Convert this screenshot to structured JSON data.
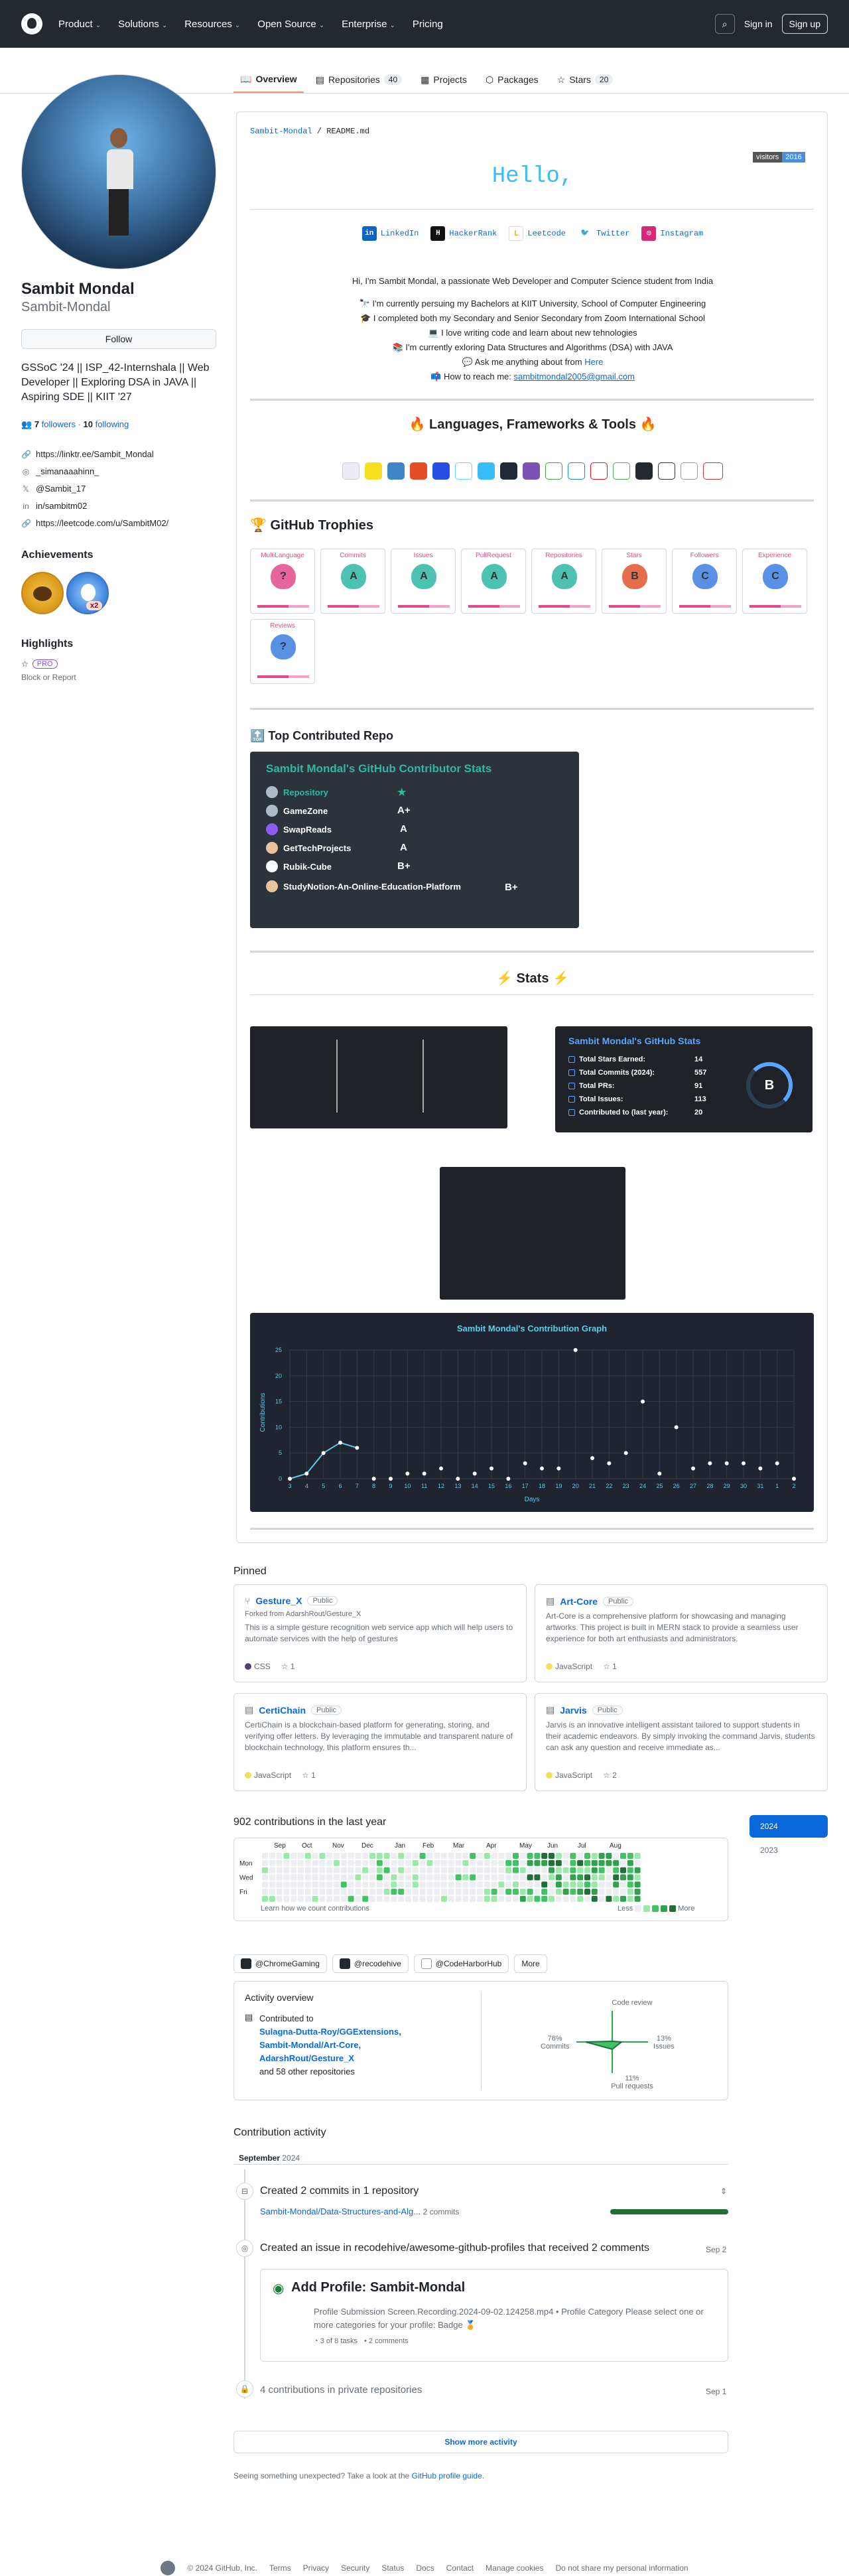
{
  "header": {
    "nav": [
      "Product",
      "Solutions",
      "Resources",
      "Open Source",
      "Enterprise",
      "Pricing"
    ],
    "sign_in": "Sign in",
    "sign_up": "Sign up"
  },
  "tabs": [
    {
      "label": "Overview"
    },
    {
      "label": "Repositories",
      "count": "40"
    },
    {
      "label": "Projects"
    },
    {
      "label": "Packages"
    },
    {
      "label": "Stars",
      "count": "20"
    }
  ],
  "profile": {
    "name": "Sambit Mondal",
    "login": "Sambit-Mondal",
    "follow": "Follow",
    "bio": "GSSoC '24 || ISP_42-Internshala || Web Developer || Exploring DSA in JAVA || Aspiring SDE || KIIT '27",
    "followers": "7",
    "followers_label": "followers",
    "following": "10",
    "following_label": "following",
    "links": [
      "https://linktr.ee/Sambit_Mondal",
      "_simanaaahinn_",
      "@Sambit_17",
      "in/sambitm02",
      "https://leetcode.com/u/SambitM02/"
    ],
    "achievements_title": "Achievements",
    "achievement_count": "x2",
    "highlights_title": "Highlights",
    "pro": "PRO",
    "block": "Block or Report"
  },
  "readme": {
    "path": "Sambit-Mondal",
    "file": "README.md",
    "hello": "Hello,",
    "visitors_label": "visitors",
    "visitors_count": "2016",
    "socials": [
      "LinkedIn",
      "HackerRank",
      "Leetcode",
      "Twitter",
      "Instagram"
    ],
    "intro": "Hi, I'm Sambit Mondal, a passionate Web Developer and Computer Science student from India",
    "points": [
      "🔭 I'm currently persuing my Bachelors at KIIT University, School of Computer Engineering",
      "🎓 I completed both my Secondary and Senior Secondary from Zoom International School",
      "💻 I love writing code and learn about new tehnologies",
      "📚 I'm currently exloring Data Structures and Algorithms (DSA) with JAVA",
      "💬 Ask me anything about from "
    ],
    "ask_link": "Here",
    "reach": "📫 How to reach me: ",
    "email": "sambitmondal2005@gmail.com",
    "langs_title": "🔥 Languages, Frameworks & Tools 🔥",
    "trophies_title": "🏆 GitHub Trophies",
    "trophies": [
      {
        "label": "MultiLanguage",
        "rank": "?",
        "color": "#e14a8b"
      },
      {
        "label": "Commits",
        "rank": "A",
        "color": "#2fb7a4"
      },
      {
        "label": "Issues",
        "rank": "A",
        "color": "#2fb7a4"
      },
      {
        "label": "PullRequest",
        "rank": "A",
        "color": "#2fb7a4"
      },
      {
        "label": "Repositories",
        "rank": "A",
        "color": "#2fb7a4"
      },
      {
        "label": "Stars",
        "rank": "B",
        "color": "#e0522d"
      },
      {
        "label": "Followers",
        "rank": "C",
        "color": "#3b7ee0"
      },
      {
        "label": "Experience",
        "rank": "C",
        "color": "#3b7ee0"
      },
      {
        "label": "Reviews",
        "rank": "?",
        "color": "#3b7ee0"
      }
    ],
    "top_repo_title": "🔝 Top Contributed Repo",
    "contrib_card": {
      "title": "Sambit Mondal's GitHub Contributor Stats",
      "rows": [
        {
          "name": "Repository",
          "rank": "★"
        },
        {
          "name": "GameZone",
          "rank": "A+"
        },
        {
          "name": "SwapReads",
          "rank": "A"
        },
        {
          "name": "GetTechProjects",
          "rank": "A"
        },
        {
          "name": "Rubik-Cube",
          "rank": "B+"
        },
        {
          "name": "StudyNotion-An-Online-Education-Platform",
          "rank": "B+"
        }
      ]
    },
    "stats_title": "⚡ Stats ⚡",
    "gh_stats": {
      "title": "Sambit Mondal's GitHub Stats",
      "rows": [
        {
          "label": "Total Stars Earned:",
          "value": "14"
        },
        {
          "label": "Total Commits (2024):",
          "value": "557"
        },
        {
          "label": "Total PRs:",
          "value": "91"
        },
        {
          "label": "Total Issues:",
          "value": "113"
        },
        {
          "label": "Contributed to (last year):",
          "value": "20"
        }
      ],
      "grade": "B"
    }
  },
  "chart_data": {
    "type": "line",
    "title": "Sambit Mondal's Contribution Graph",
    "xlabel": "Days",
    "ylabel": "Contributions",
    "x": [
      3,
      4,
      5,
      6,
      7,
      8,
      9,
      10,
      11,
      12,
      13,
      14,
      15,
      16,
      17,
      18,
      19,
      20,
      21,
      22,
      23,
      24,
      25,
      26,
      27,
      28,
      29,
      30,
      31,
      1,
      2
    ],
    "values": [
      0,
      1,
      5,
      7,
      6,
      0,
      0,
      1,
      1,
      2,
      0,
      1,
      2,
      0,
      3,
      2,
      2,
      25,
      4,
      3,
      5,
      15,
      1,
      10,
      2,
      3,
      3,
      3,
      2,
      3,
      0
    ],
    "ylim": [
      0,
      25
    ],
    "yticks": [
      0,
      5,
      10,
      15,
      20,
      25
    ],
    "grid": true
  },
  "pinned": {
    "title": "Pinned",
    "items": [
      {
        "name": "Gesture_X",
        "vis": "Public",
        "fork": "Forked from AdarshRout/Gesture_X",
        "desc": "This is a simple gesture recognition web service app which will help users to automate services with the help of gestures",
        "lang": "CSS",
        "lang_color": "#563d7c",
        "stars": "1"
      },
      {
        "name": "Art-Core",
        "vis": "Public",
        "fork": "",
        "desc": "Art-Core is a comprehensive platform for showcasing and managing artworks. This project is built in MERN stack to provide a seamless user experience for both art enthusiasts and administrators.",
        "lang": "JavaScript",
        "lang_color": "#f1e05a",
        "stars": "1"
      },
      {
        "name": "CertiChain",
        "vis": "Public",
        "fork": "",
        "desc": "CertiChain is a blockchain-based platform for generating, storing, and verifying offer letters. By leveraging the immutable and transparent nature of blockchain technology, this platform ensures th...",
        "lang": "JavaScript",
        "lang_color": "#f1e05a",
        "stars": "1"
      },
      {
        "name": "Jarvis",
        "vis": "Public",
        "fork": "",
        "desc": "Jarvis is an innovative intelligent assistant tailored to support students in their academic endeavors. By simply invoking the command Jarvis, students can ask any question and receive immediate as...",
        "lang": "JavaScript",
        "lang_color": "#f1e05a",
        "stars": "2"
      }
    ]
  },
  "contributions": {
    "title": "902 contributions in the last year",
    "months": [
      "Sep",
      "Oct",
      "Nov",
      "Dec",
      "Jan",
      "Feb",
      "Mar",
      "Apr",
      "May",
      "Jun",
      "Jul",
      "Aug"
    ],
    "days": [
      "Mon",
      "Wed",
      "Fri"
    ],
    "learn": "Learn how we count contributions",
    "less": "Less",
    "more": "More",
    "years": [
      "2024",
      "2023"
    ],
    "orgs": [
      "@ChromeGaming",
      "@recodehive",
      "@CodeHarborHub",
      "More"
    ],
    "activity_title": "Activity overview",
    "contributed_to": "Contributed to",
    "repos": [
      "Sulagna-Dutta-Roy/GGExtensions,",
      "Sambit-Mondal/Art-Core,",
      "AdarshRout/Gesture_X"
    ],
    "others": "and 58 other repositories",
    "radar": {
      "code_review": "Code review",
      "commits_pct": "76%",
      "commits": "Commits",
      "issues_pct": "13%",
      "issues": "Issues",
      "prs_pct": "11%",
      "prs": "Pull requests"
    }
  },
  "activity": {
    "title": "Contribution activity",
    "month": "September",
    "year": "2024",
    "commits_ev": "Created 2 commits in 1 repository",
    "commit_repo": "Sambit-Mondal/Data-Structures-and-Alg...",
    "commit_count": "2 commits",
    "issue_ev": "Created an issue in recodehive/awesome-github-profiles that received 2 comments",
    "issue_date": "Sep 2",
    "issue_title": "Add Profile: Sambit-Mondal",
    "issue_body": "Profile Submission    Screen.Recording.2024-09-02.124258.mp4  • Profile Category Please select one or more categories for your profile: Badge 🏅",
    "tasks": "3 of 8 tasks",
    "comments": "2 comments",
    "private": "4 contributions in private repositories",
    "private_date": "Sep 1",
    "show_more": "Show more activity",
    "unexpected": "Seeing something unexpected? Take a look at the ",
    "guide": "GitHub profile guide",
    "guide_end": "."
  },
  "footer": [
    "© 2024 GitHub, Inc.",
    "Terms",
    "Privacy",
    "Security",
    "Status",
    "Docs",
    "Contact",
    "Manage cookies",
    "Do not share my personal information"
  ]
}
